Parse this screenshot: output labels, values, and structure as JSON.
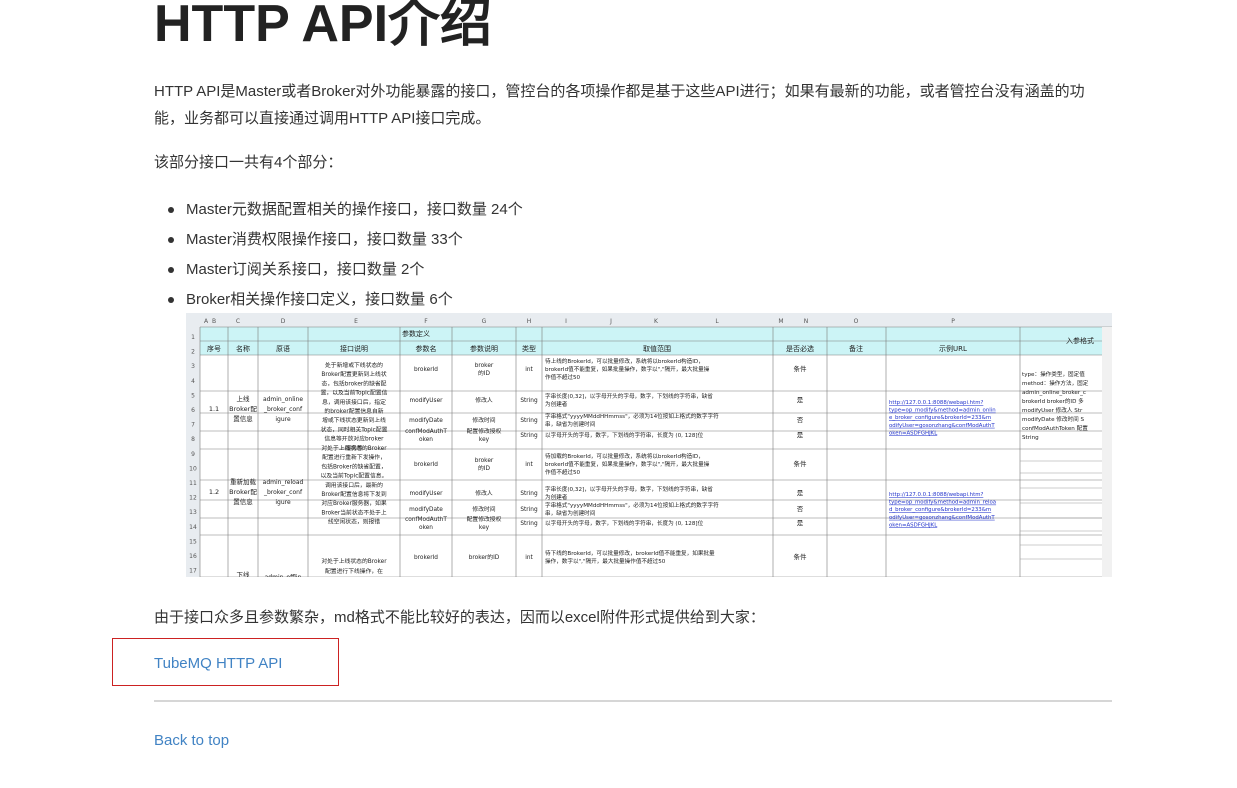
{
  "page": {
    "title": "HTTP API介绍",
    "intro": "HTTP API是Master或者Broker对外功能暴露的接口，管控台的各项操作都是基于这些API进行；如果有最新的功能，或者管控台没有涵盖的功能，业务都可以直接通过调用HTTP API接口完成。",
    "parts_text": "该部分接口一共有4个部分：",
    "parts": [
      "Master元数据配置相关的操作接口，接口数量 24个",
      "Master消费权限操作接口，接口数量 33个",
      "Master订阅关系接口，接口数量 2个",
      "Broker相关操作接口定义，接口数量 6个"
    ],
    "note": "由于接口众多且参数繁杂，md格式不能比较好的表达，因而以excel附件形式提供给到大家：",
    "attachment_link": "TubeMQ HTTP API",
    "back_to_top": "Back to top"
  },
  "sheet": {
    "col_letters": [
      "A",
      "B",
      "C",
      "D",
      "E",
      "F",
      "G",
      "H",
      "I",
      "J",
      "K",
      "L",
      "M",
      "N",
      "O",
      "P"
    ],
    "row_numbers": [
      "1",
      "2",
      "3",
      "4",
      "5",
      "6",
      "7",
      "8",
      "9",
      "10",
      "11",
      "12",
      "13",
      "14",
      "15",
      "16",
      "17"
    ],
    "group_header": "参数定义",
    "headers": {
      "seq": "序号",
      "name": "名称",
      "api": "原语",
      "desc": "接口说明",
      "param": "参数名",
      "pdesc": "参数说明",
      "type": "类型",
      "range": "取值范围",
      "required": "是否必选",
      "remark": "备注",
      "url": "示例URL",
      "input": "入参格式"
    },
    "block1": {
      "seq": "1.1",
      "name": [
        "上线",
        "Broker配",
        "置信息"
      ],
      "api": [
        "admin_online",
        "_broker_conf",
        "igure"
      ],
      "desc": [
        "处于新增或下线状态的",
        "Broker配置更新到上线状",
        "态，包括broker的缺省配",
        "置，以及当前Topic配置信",
        "息，调用该接口后，指定",
        "的broker配置信息自新",
        "增或下线状态更新到上线",
        "状态，同时相关Topic配置",
        "信息等开放对应broker",
        "服务等"
      ],
      "rows": [
        {
          "param": "brokerId",
          "pdesc": "broker的ID",
          "type": "int",
          "range": [
            "待上线的BrokerId，可以批量修改，系统将以brokerId构造ID，",
            "brokerId值不能重复，如果批量操作，数字以\",\"隔开，最大批量操",
            "作值不超过50"
          ],
          "req": "条件"
        },
        {
          "param": "modifyUser",
          "pdesc": "修改人",
          "type": "String",
          "range": [
            "字串长度(0,32]，以字母开头的字母，数字，下划线的字符串，缺省",
            "为创建者"
          ],
          "req": "是"
        },
        {
          "param": "modifyDate",
          "pdesc": "修改时间",
          "type": "String",
          "range": [
            "字串格式\"yyyyMMddHHmmss\"，必须为14位按如上格式的数字字符",
            "串，缺省为创建时间"
          ],
          "req": "否"
        },
        {
          "param": "confModAuthToken",
          "pdesc": "配置修改授权key",
          "type": "String",
          "range": [
            "以字母开头的字母，数字，下划线的字符串，长度为 (0, 128]位"
          ],
          "req": "是"
        }
      ],
      "url": [
        "http://127.0.0.1:8088/webapi.htm?",
        "type=op_modify&method=admin_onlin",
        "e_broker_configure&brokerId=233&m",
        "odifyUser=gosonzhang&confModAuthT",
        "oken=ASDFGHJKL"
      ],
      "input": [
        "type：操作类型，固定值",
        "method：操作方法，固定",
        "admin_online_broker_c",
        "brokerId broker的ID 多",
        "modifyUser 修改人 Str",
        "modifyDate 修改时间 S",
        "confModAuthToken 配置",
        "String"
      ]
    },
    "block2": {
      "seq": "1.2",
      "name": [
        "重新加载",
        "Broker配",
        "置信息"
      ],
      "api": [
        "admin_reload",
        "_broker_conf",
        "igure"
      ],
      "desc": [
        "对处于上线状态的Broker",
        "配置进行重新下发操作，",
        "包括Broker的缺省配置，",
        "以及当前Topic配置信息。",
        "调用该接口后，最新的",
        "Broker配置信息将下发到",
        "对应Broker服务器，如果",
        "Broker当前状态不处于上",
        "线空闲状态，则报错"
      ],
      "rows": [
        {
          "param": "brokerId",
          "pdesc": "broker的ID",
          "type": "int",
          "range": [
            "待加载的BrokerId，可以批量修改，系统将以brokerId构造ID，",
            "brokerId值不能重复，如果批量操作，数字以\",\"隔开，最大批量操",
            "作值不超过50"
          ],
          "req": "条件"
        },
        {
          "param": "modifyUser",
          "pdesc": "修改人",
          "type": "String",
          "range": [
            "字串长度(0,32]，以字母开头的字母，数字，下划线的字符串，缺省",
            "为创建者"
          ],
          "req": "是"
        },
        {
          "param": "modifyDate",
          "pdesc": "修改时间",
          "type": "String",
          "range": [
            "字串格式\"yyyyMMddHHmmss\"，必须为14位按如上格式的数字字符",
            "串，缺省为创建时间"
          ],
          "req": "否"
        },
        {
          "param": "confModAuthToken",
          "pdesc": "配置修改授权key",
          "type": "String",
          "range": [
            "以字母开头的字母，数字，下划线的字符串，长度为 (0, 128]位"
          ],
          "req": "是"
        }
      ],
      "url": [
        "http://127.0.0.1:8088/webapi.htm?",
        "type=op_modify&method=admin_reloa",
        "d_broker_configure&brokerId=233&m",
        "odifyUser=gosonzhang&confModAuthT",
        "oken=ASDFGHJKL"
      ]
    },
    "block3": {
      "name": "下线",
      "api": "admin_offlin",
      "desc": [
        "对处于上线状态的Broker",
        "配置进行下线操作，在"
      ],
      "row": {
        "param": "brokerId",
        "pdesc": "broker的ID",
        "type": "int",
        "range": [
          "待下线的BrokerId，可以批量修改，brokerId值不能重复，如果批量",
          "操作，数字以\",\"隔开，最大批量操作值不超过50"
        ],
        "req": "条件"
      }
    }
  }
}
